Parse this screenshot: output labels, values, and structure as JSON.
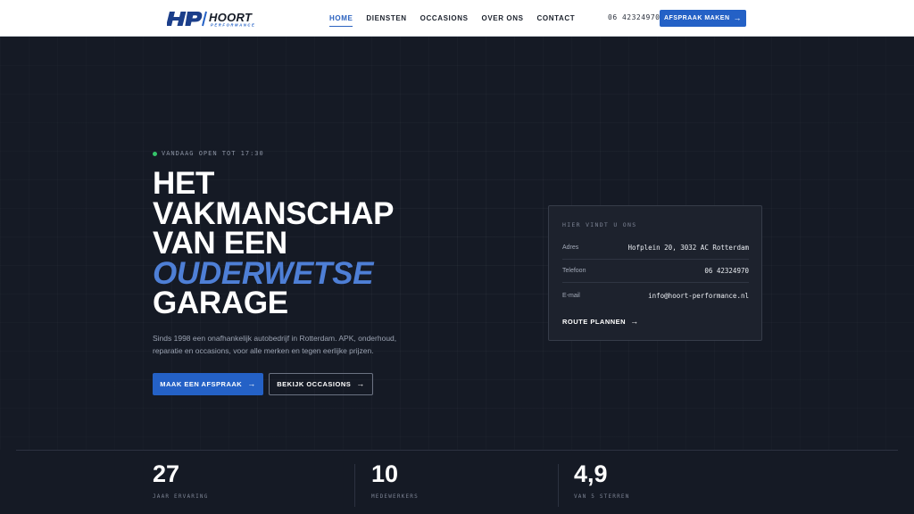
{
  "header": {
    "logo_text": "HP HOORT PERFORMANCE",
    "nav": [
      {
        "label": "HOME",
        "active": true
      },
      {
        "label": "DIENSTEN",
        "active": false
      },
      {
        "label": "OCCASIONS",
        "active": false
      },
      {
        "label": "OVER ONS",
        "active": false
      },
      {
        "label": "CONTACT",
        "active": false
      }
    ],
    "phone": "06 42324970",
    "cta_label": "AFSPRAAK MAKEN",
    "cta_arrow": "→"
  },
  "hero": {
    "status": "VANDAAG OPEN TOT 17:30",
    "headline": {
      "line1": "HET",
      "line2": "VAKMANSCHAP",
      "line3": "VAN EEN",
      "line4_accent": "OUDERWETSE",
      "line5": "GARAGE"
    },
    "lead": "Sinds 1998 een onafhankelijk autobedrijf in Rotterdam. APK, onderhoud, reparatie en occasions, voor alle merken en tegen eerlijke prijzen.",
    "primary_button": "MAAK EEN AFSPRAAK",
    "secondary_button": "BEKIJK OCCASIONS",
    "arrow": "→"
  },
  "card": {
    "title": "HIER VINDT U ONS",
    "rows": [
      {
        "label": "Adres",
        "value": "Hofplein 20, 3032 AC Rotterdam"
      },
      {
        "label": "Telefoon",
        "value": "06 42324970"
      },
      {
        "label": "E-mail",
        "value": "info@hoort-performance.nl"
      }
    ],
    "link_label": "ROUTE PLANNEN",
    "arrow": "→"
  },
  "stats": [
    {
      "value": "27",
      "label": "JAAR ERVARING"
    },
    {
      "value": "10",
      "label": "MEDEWERKERS"
    },
    {
      "value": "4,9",
      "label": "VAN 5 STERREN"
    }
  ],
  "colors": {
    "accent": "#2461c6",
    "accent_text": "#4e7fd6",
    "background": "#151a25",
    "status_dot": "#35c46a"
  }
}
